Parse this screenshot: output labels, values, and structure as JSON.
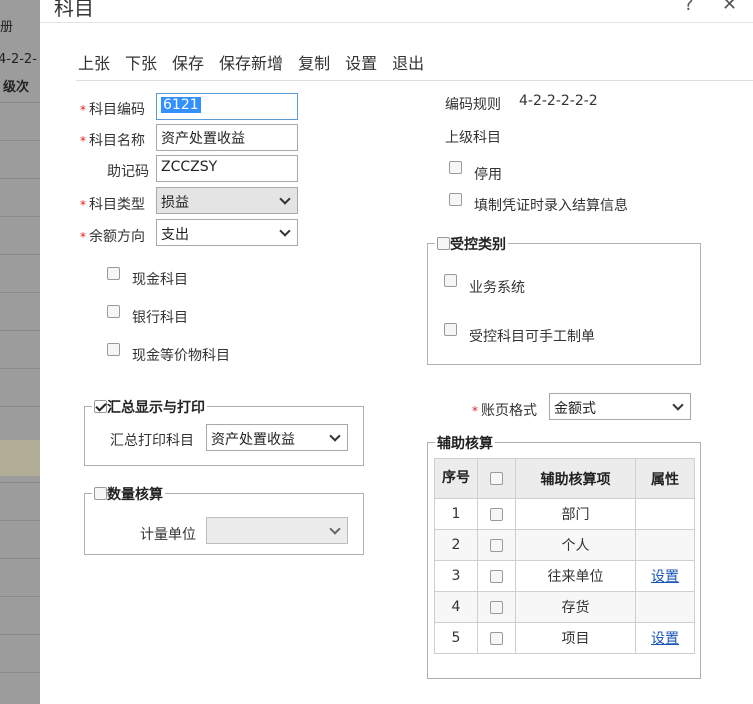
{
  "background": {
    "fragments": [
      "册",
      "4-2-2-",
      "级次"
    ]
  },
  "dialog": {
    "title": "科目",
    "help_glyph": "?",
    "close_glyph": "✕"
  },
  "toolbar": {
    "prev": "上张",
    "next": "下张",
    "save": "保存",
    "save_new": "保存新增",
    "copy": "复制",
    "settings": "设置",
    "exit": "退出"
  },
  "form": {
    "code": {
      "label": "科目编码",
      "value": "6121"
    },
    "name": {
      "label": "科目名称",
      "value": "资产处置收益"
    },
    "mnemonic": {
      "label": "助记码",
      "value": "ZCCZSY"
    },
    "type": {
      "label": "科目类型",
      "value": "损益"
    },
    "balance_direction": {
      "label": "余额方向",
      "value": "支出"
    },
    "cash": {
      "label": "现金科目",
      "checked": false
    },
    "bank": {
      "label": "银行科目",
      "checked": false
    },
    "cash_equiv": {
      "label": "现金等价物科目",
      "checked": false
    }
  },
  "right": {
    "code_rule_label": "编码规则",
    "code_rule_value": "4-2-2-2-2-2",
    "parent_label": "上级科目",
    "disabled_label": "停用",
    "settle_label": "填制凭证时录入结算信息"
  },
  "controlled": {
    "legend": "受控类别",
    "business_system": "业务系统",
    "manual_entry": "受控科目可手工制单"
  },
  "summary": {
    "legend": "汇总显示与打印",
    "checked": true,
    "print_label": "汇总打印科目",
    "print_value": "资产处置收益"
  },
  "quantity": {
    "legend": "数量核算",
    "checked": false,
    "unit_label": "计量单位",
    "unit_value": ""
  },
  "ledger": {
    "label": "账页格式",
    "value": "金额式"
  },
  "assist": {
    "legend": "辅助核算",
    "headers": {
      "seq": "序号",
      "item": "辅助核算项",
      "attr": "属性"
    },
    "rows": [
      {
        "seq": "1",
        "item": "部门",
        "attr": ""
      },
      {
        "seq": "2",
        "item": "个人",
        "attr": ""
      },
      {
        "seq": "3",
        "item": "往来单位",
        "attr": "设置"
      },
      {
        "seq": "4",
        "item": "存货",
        "attr": ""
      },
      {
        "seq": "5",
        "item": "项目",
        "attr": "设置"
      }
    ]
  },
  "colors": {
    "required": "#e02020",
    "link": "#1a55b8",
    "selection": "#3390ff"
  }
}
